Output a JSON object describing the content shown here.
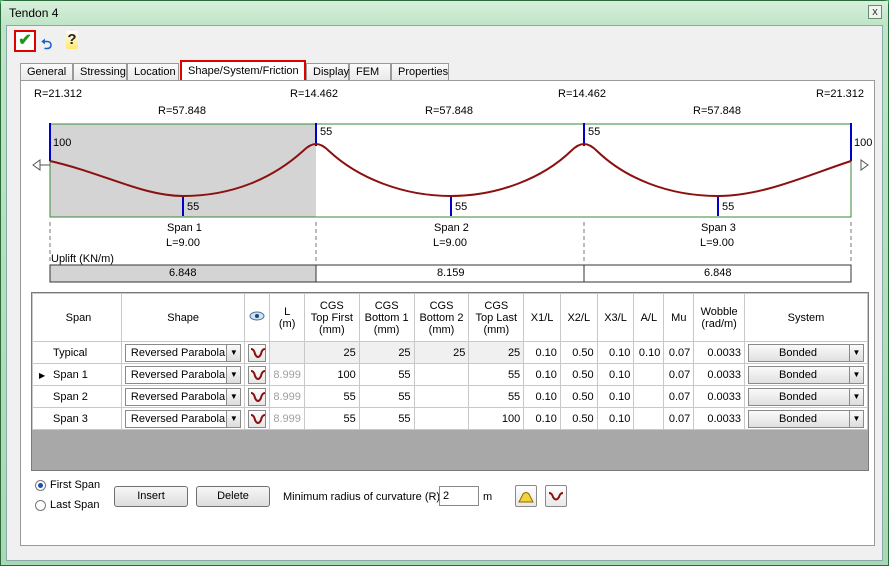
{
  "window": {
    "title": "Tendon 4",
    "close": "x"
  },
  "toolbar": {
    "ok_icon": "checkmark-icon",
    "link_icon": "link-icon",
    "help_icon": "help-icon",
    "ok_glyph": "✔",
    "link_glyph": "⮌",
    "help_glyph": "?"
  },
  "tabs": [
    "General",
    "Stressing",
    "Location",
    "Shape/System/Friction",
    "Display",
    "FEM",
    "Properties"
  ],
  "active_tab": "Shape/System/Friction",
  "diagram": {
    "radius_top": [
      "R=21.312",
      "R=14.462",
      "R=14.462",
      "R=21.312"
    ],
    "radius_span": [
      "R=57.848",
      "R=57.848",
      "R=57.848"
    ],
    "heights": {
      "left": "100",
      "mid1": "55",
      "mid2": "55",
      "right": "100",
      "low1": "55",
      "low2": "55",
      "low3": "55"
    },
    "spans": [
      {
        "name": "Span 1",
        "length": "L=9.00"
      },
      {
        "name": "Span 2",
        "length": "L=9.00"
      },
      {
        "name": "Span 3",
        "length": "L=9.00"
      }
    ],
    "uplift_label": "Uplift (KN/m)",
    "uplift": [
      "6.848",
      "8.159",
      "6.848"
    ],
    "colors": {
      "profile": "#8b1010",
      "support": "#0000cc",
      "frame": "#3a8a3a",
      "selected_span": "#d4d4d4"
    }
  },
  "grid": {
    "headers": {
      "span": "Span",
      "shape": "Shape",
      "eye_icon": "eye-icon",
      "L": "L",
      "L_unit": "(m)",
      "cgs_top_first": [
        "CGS",
        "Top First",
        "(mm)"
      ],
      "cgs_bottom1": [
        "CGS",
        "Bottom 1",
        "(mm)"
      ],
      "cgs_bottom2": [
        "CGS",
        "Bottom 2",
        "(mm)"
      ],
      "cgs_top_last": [
        "CGS",
        "Top Last",
        "(mm)"
      ],
      "x1": "X1/L",
      "x2": "X2/L",
      "x3": "X3/L",
      "al": "A/L",
      "mu": "Mu",
      "wobble": [
        "Wobble",
        "(rad/m)"
      ],
      "system": "System"
    },
    "rows": [
      {
        "span": "Typical",
        "shape": "Reversed Parabola",
        "L": "",
        "top_first": "25",
        "bottom1": "25",
        "bottom2": "25",
        "top_last": "25",
        "x1": "0.10",
        "x2": "0.50",
        "x3": "0.10",
        "al": "0.10",
        "mu": "0.07",
        "wobble": "0.0033",
        "system": "Bonded",
        "marker": ""
      },
      {
        "span": "Span 1",
        "shape": "Reversed Parabola",
        "L": "8.999",
        "top_first": "100",
        "bottom1": "55",
        "bottom2": "",
        "top_last": "55",
        "x1": "0.10",
        "x2": "0.50",
        "x3": "0.10",
        "al": "",
        "mu": "0.07",
        "wobble": "0.0033",
        "system": "Bonded",
        "marker": "▶"
      },
      {
        "span": "Span 2",
        "shape": "Reversed Parabola",
        "L": "8.999",
        "top_first": "55",
        "bottom1": "55",
        "bottom2": "",
        "top_last": "55",
        "x1": "0.10",
        "x2": "0.50",
        "x3": "0.10",
        "al": "",
        "mu": "0.07",
        "wobble": "0.0033",
        "system": "Bonded",
        "marker": ""
      },
      {
        "span": "Span 3",
        "shape": "Reversed Parabola",
        "L": "8.999",
        "top_first": "55",
        "bottom1": "55",
        "bottom2": "",
        "top_last": "100",
        "x1": "0.10",
        "x2": "0.50",
        "x3": "0.10",
        "al": "",
        "mu": "0.07",
        "wobble": "0.0033",
        "system": "Bonded",
        "marker": ""
      }
    ]
  },
  "bottom": {
    "first_span": "First Span",
    "last_span": "Last Span",
    "selected": "First Span",
    "insert": "Insert",
    "delete": "Delete",
    "min_radius_label": "Minimum radius of curvature (R):",
    "min_radius_value": "2",
    "min_radius_unit": "m"
  }
}
